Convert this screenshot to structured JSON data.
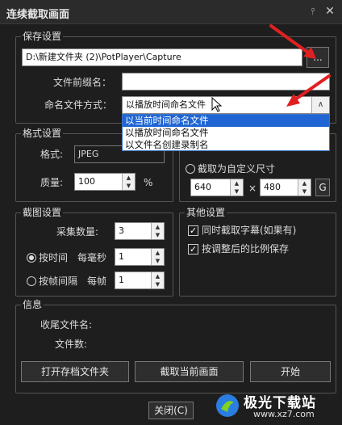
{
  "window": {
    "title": "连续截取画面"
  },
  "save": {
    "group_title": "保存设置",
    "path_value": "D:\\新建文件夹 (2)\\PotPlayer\\Capture",
    "browse_label": "...",
    "prefix_label": "文件前缀名：",
    "prefix_value": "",
    "naming_label": "命名文件方式：",
    "naming_selected": "以播放时间命名文件",
    "naming_options": [
      "以当前时间命名文件",
      "以播放时间命名文件",
      "以文件名创建录制名"
    ],
    "highlighted_option": "以当前时间命名文件"
  },
  "format": {
    "group_title": "格式设置",
    "format_label": "格式:",
    "format_value": "JPEG",
    "quality_label": "质量:",
    "quality_value": "100",
    "quality_unit": "%"
  },
  "size": {
    "custom_label": "截取为自定义尺寸",
    "width": "640",
    "height": "480",
    "times": "×",
    "g_label": "G"
  },
  "capture": {
    "group_title": "截图设置",
    "count_label": "采集数量:",
    "count_value": "3",
    "by_time_label": "按时间",
    "per_ms_label": "每毫秒",
    "by_time_value": "1",
    "by_frame_label": "按帧间隔",
    "per_frame_label": "每帧",
    "by_frame_value": "1"
  },
  "other": {
    "group_title": "其他设置",
    "subtitle_label": "同时截取字幕(如果有)",
    "ratio_label": "按调整后的比例保存"
  },
  "info": {
    "group_title": "信息",
    "last_file_label": "收尾文件名:",
    "file_count_label": "文件数:"
  },
  "actions": {
    "open_folder": "打开存档文件夹",
    "capture_current": "截取当前画面",
    "start": "开始",
    "close": "关闭(C)"
  },
  "watermark": {
    "text": "极光下载站",
    "url": "www.xz7.com"
  }
}
